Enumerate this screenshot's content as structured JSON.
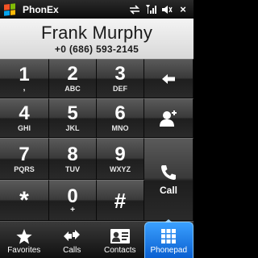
{
  "titlebar": {
    "app_title": "PhonEx",
    "close_label": "×",
    "icons": [
      "windows-start-icon",
      "sync-icon",
      "signal-icon",
      "speaker-icon",
      "close-icon"
    ]
  },
  "contact": {
    "name": "Frank Murphy",
    "number": "+0 (686) 593-2145"
  },
  "keys": [
    {
      "digit": "1",
      "sub": "◌,",
      "name": "key-1"
    },
    {
      "digit": "2",
      "sub": "ABC",
      "name": "key-2"
    },
    {
      "digit": "3",
      "sub": "DEF",
      "name": "key-3"
    },
    {
      "digit": "4",
      "sub": "GHI",
      "name": "key-4"
    },
    {
      "digit": "5",
      "sub": "JKL",
      "name": "key-5"
    },
    {
      "digit": "6",
      "sub": "MNO",
      "name": "key-6"
    },
    {
      "digit": "7",
      "sub": "PQRS",
      "name": "key-7"
    },
    {
      "digit": "8",
      "sub": "TUV",
      "name": "key-8"
    },
    {
      "digit": "9",
      "sub": "WXYZ",
      "name": "key-9"
    },
    {
      "digit": "*",
      "sub": "",
      "name": "key-star"
    },
    {
      "digit": "0",
      "sub": "+",
      "name": "key-0"
    },
    {
      "digit": "#",
      "sub": "",
      "name": "key-hash"
    }
  ],
  "side_keys": {
    "backspace_icon": "backspace-arrow-icon",
    "add_contact_icon": "add-contact-icon",
    "call_label": "Call",
    "call_icon": "phone-handset-icon"
  },
  "key1_sub": ",",
  "tabs": [
    {
      "label": "Favorites",
      "icon": "star-icon",
      "active": false
    },
    {
      "label": "Calls",
      "icon": "calls-arrows-icon",
      "active": false
    },
    {
      "label": "Contacts",
      "icon": "contact-card-icon",
      "active": false
    },
    {
      "label": "Phonepad",
      "icon": "keypad-grid-icon",
      "active": true
    }
  ],
  "colors": {
    "active_tab": "#1a7ae8",
    "header_bg": "#e6e6e6",
    "key_bg": "#3a3a3a"
  }
}
